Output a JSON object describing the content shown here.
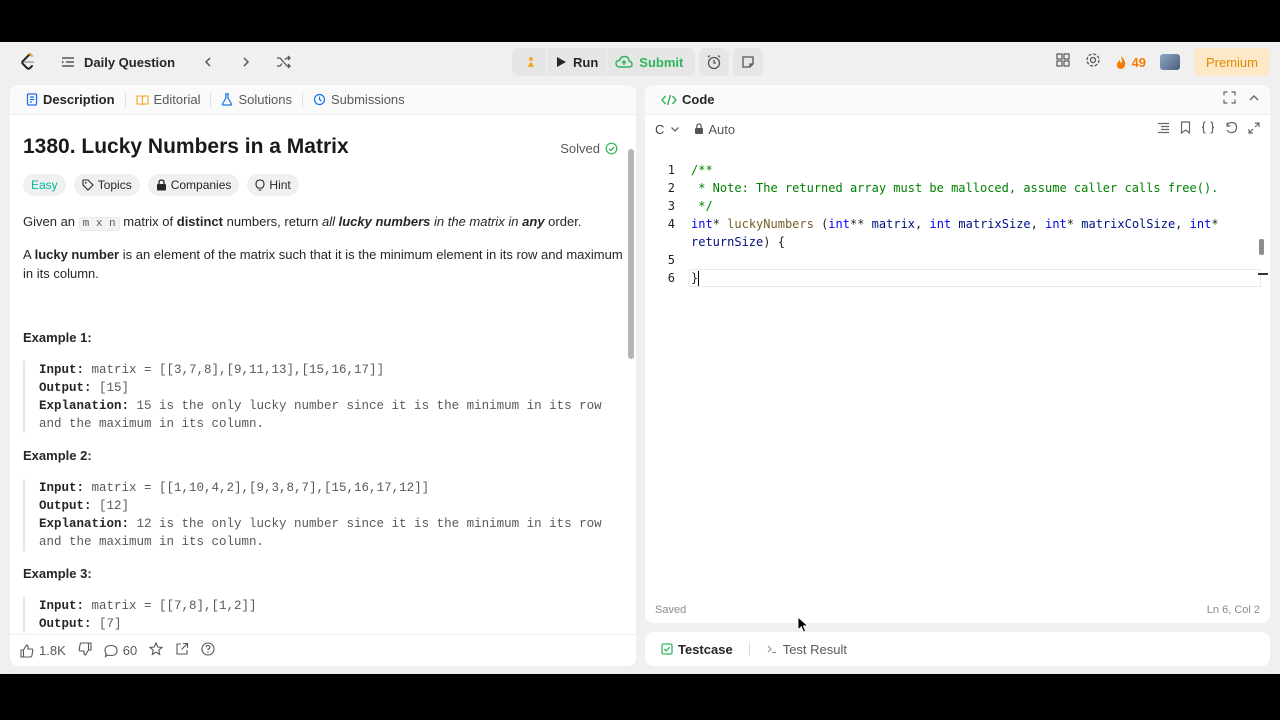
{
  "topbar": {
    "daily_question": "Daily Question",
    "run_label": "Run",
    "submit_label": "Submit",
    "streak_count": "49",
    "premium_label": "Premium"
  },
  "left_tabs": [
    "Description",
    "Editorial",
    "Solutions",
    "Submissions"
  ],
  "problem": {
    "title": "1380. Lucky Numbers in a Matrix",
    "status": "Solved",
    "difficulty": "Easy",
    "chips": [
      "Topics",
      "Companies",
      "Hint"
    ],
    "para1": {
      "a": "Given an ",
      "code": "m x n",
      "b": " matrix of ",
      "c": "distinct",
      "d": " numbers, return ",
      "e": "all",
      "f": "lucky numbers",
      "g": " in the matrix in ",
      "h": "any",
      "i": " order."
    },
    "para2": {
      "a": "A ",
      "b": "lucky number",
      "c": " is an element of the matrix such that it is the minimum element in its row and maximum in its column."
    },
    "examples": [
      {
        "title": "Example 1:",
        "input_label": "Input:",
        "input": " matrix = [[3,7,8],[9,11,13],[15,16,17]]",
        "output_label": "Output:",
        "output": " [15]",
        "explanation_label": "Explanation:",
        "explanation": " 15 is the only lucky number since it is the minimum in its row",
        "explanation2": "and the maximum in its column."
      },
      {
        "title": "Example 2:",
        "input_label": "Input:",
        "input": " matrix = [[1,10,4,2],[9,3,8,7],[15,16,17,12]]",
        "output_label": "Output:",
        "output": " [12]",
        "explanation_label": "Explanation:",
        "explanation": " 12 is the only lucky number since it is the minimum in its row",
        "explanation2": "and the maximum in its column."
      },
      {
        "title": "Example 3:",
        "input_label": "Input:",
        "input": " matrix = [[7,8],[1,2]]",
        "output_label": "Output:",
        "output": " [7]"
      }
    ]
  },
  "footer": {
    "likes": "1.8K",
    "comments": "60"
  },
  "code": {
    "panel_title": "Code",
    "language": "C",
    "mode": "Auto",
    "line_numbers": [
      "1",
      "2",
      "3",
      "4",
      "5",
      "6"
    ],
    "status_left": "Saved",
    "status_right": "Ln 6, Col 2"
  },
  "bottom_tabs": {
    "testcase": "Testcase",
    "test_result": "Test Result"
  },
  "colors": {
    "accent_green": "#2db55d",
    "easy": "#00b8a3",
    "streak": "#f57c00",
    "premium": "#e08a00"
  }
}
